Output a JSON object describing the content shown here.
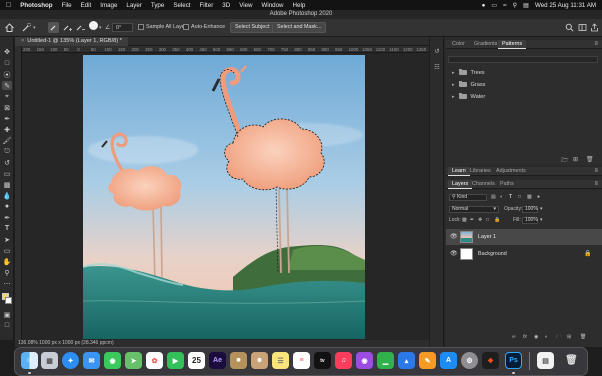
{
  "menubar": {
    "items": [
      "Photoshop",
      "File",
      "Edit",
      "Image",
      "Layer",
      "Type",
      "Select",
      "Filter",
      "3D",
      "View",
      "Window",
      "Help"
    ],
    "clock": "Wed 25 Aug  11:31 AM"
  },
  "window_title": "Adobe Photoshop 2020",
  "optionsbar": {
    "angle_value": "0°",
    "sample_all_layers": "Sample All Layers",
    "auto_enhance": "Auto-Enhance",
    "select_subject": "Select Subject",
    "select_and_mask": "Select and Mask..."
  },
  "document": {
    "tab_title": "Untitled-1 @ 135% (Layer 1, RGB/8) *",
    "ruler_ticks": [
      "200",
      "150",
      "100",
      "50",
      "0",
      "50",
      "100",
      "150",
      "200",
      "250",
      "300",
      "350",
      "400",
      "450",
      "500",
      "550",
      "600",
      "650",
      "700",
      "750",
      "800",
      "850",
      "900",
      "950",
      "1000",
      "1050",
      "1100",
      "1150",
      "1200",
      "1250"
    ],
    "status": "136.08%   1000 px x 1000 px (28.346 ppcm)"
  },
  "patterns_panel": {
    "tabs": [
      "Color",
      "Gradients",
      "Patterns"
    ],
    "active_tab": "Patterns",
    "groups": [
      "Trees",
      "Grass",
      "Water"
    ]
  },
  "learn_panel": {
    "tabs": [
      "Learn",
      "Libraries",
      "Adjustments"
    ]
  },
  "layers_panel": {
    "tabs": [
      "Layers",
      "Channels",
      "Paths"
    ],
    "filter_kind": "Kind",
    "blend_mode": "Normal",
    "opacity_label": "Opacity:",
    "opacity_value": "100%",
    "lock_label": "Lock:",
    "fill_label": "Fill:",
    "fill_value": "100%",
    "layers": [
      {
        "name": "Layer 1",
        "selected": true
      },
      {
        "name": "Background",
        "selected": false
      }
    ]
  },
  "dock": {
    "calendar_day": "25",
    "ae_label": "Ae",
    "ps_label": "Ps"
  },
  "colors": {
    "accent": "#1473e6",
    "panel": "#2d2d2d",
    "sky_top": "#7fb4d9",
    "sky_bottom": "#f1c4ae",
    "water": "#2f8a86"
  }
}
